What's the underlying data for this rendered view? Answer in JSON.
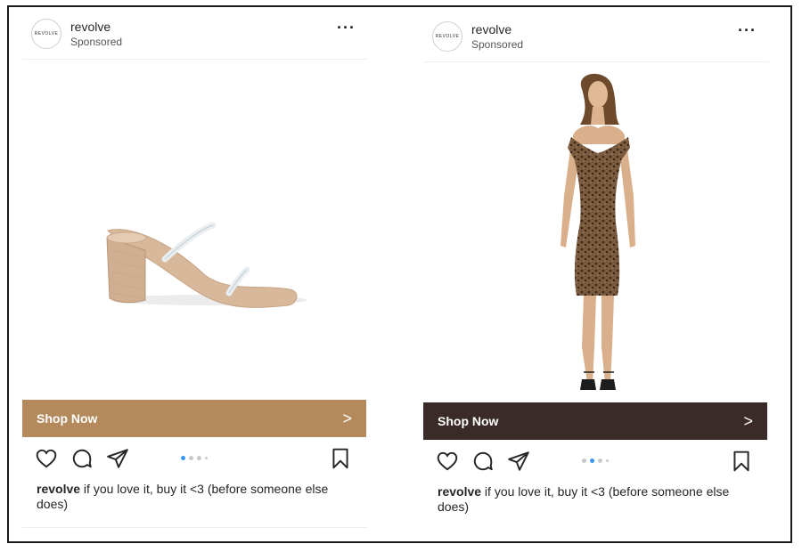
{
  "posts": [
    {
      "brand_logo_text": "REVOLVE",
      "username": "revolve",
      "sponsored_label": "Sponsored",
      "more_icon": "···",
      "cta_label": "Shop Now",
      "cta_chevron": ">",
      "cta_color": "#b48a5c",
      "product": "heeled-sandal",
      "caption_user": "revolve",
      "caption_text": " if you love it, buy it <3 (before someone else does)",
      "carousel": {
        "total": 4,
        "active_index": 0
      }
    },
    {
      "brand_logo_text": "REVOLVE",
      "username": "revolve",
      "sponsored_label": "Sponsored",
      "more_icon": "···",
      "cta_label": "Shop Now",
      "cta_chevron": ">",
      "cta_color": "#3a2b28",
      "product": "leopard-print-dress",
      "caption_user": "revolve",
      "caption_text": " if you love it, buy it <3 (before someone else does)",
      "carousel": {
        "total": 4,
        "active_index": 1
      }
    }
  ],
  "icons": {
    "like": "heart-icon",
    "comment": "comment-icon",
    "share": "paper-plane-icon",
    "save": "bookmark-icon"
  },
  "colors": {
    "dot_active": "#3897f0",
    "dot_inactive": "#c8c8c8",
    "border": "#1a1a1a"
  }
}
